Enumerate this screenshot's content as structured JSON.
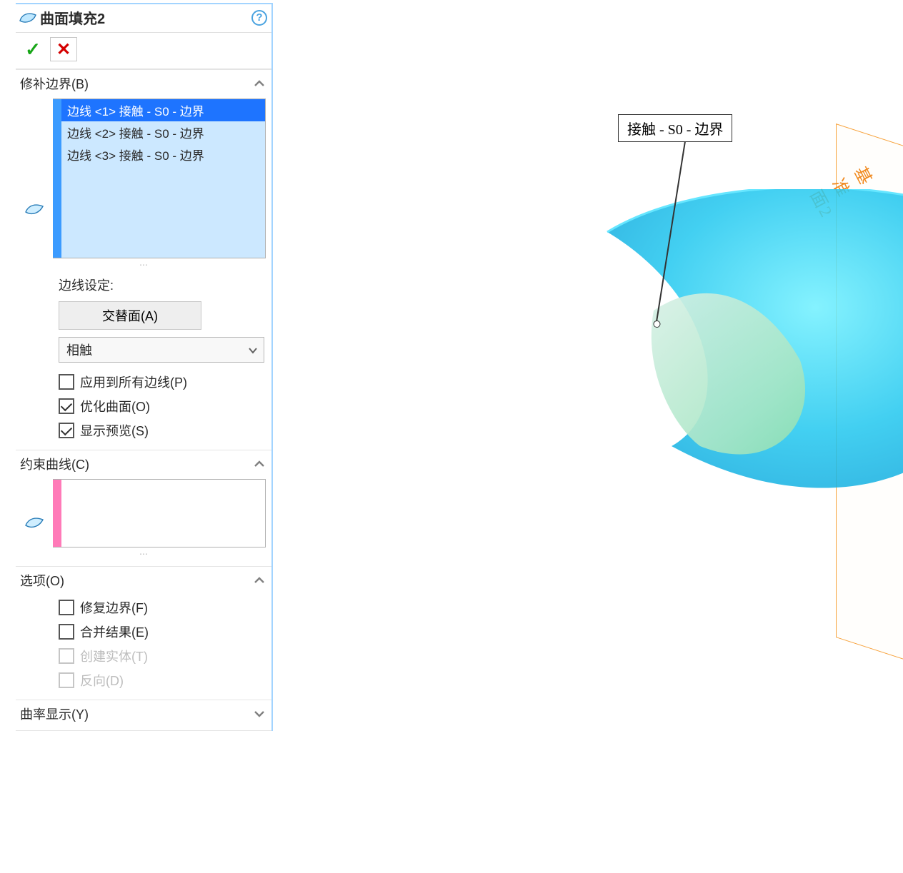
{
  "header": {
    "title": "曲面填充2"
  },
  "sections": {
    "patch_boundary": {
      "title": "修补边界(B)",
      "edges": [
        "边线 <1> 接触 - S0 - 边界",
        "边线 <2> 接触 - S0 - 边界",
        "边线 <3> 接触 - S0 - 边界"
      ],
      "selected_index": 0,
      "edge_settings_label": "边线设定:",
      "alternate_face_btn": "交替面(A)",
      "contact_combo": "相触",
      "apply_all_label": "应用到所有边线(P)",
      "apply_all_checked": false,
      "optimize_label": "优化曲面(O)",
      "optimize_checked": true,
      "preview_label": "显示预览(S)",
      "preview_checked": true
    },
    "constraint_curves": {
      "title": "约束曲线(C)"
    },
    "options": {
      "title": "选项(O)",
      "fix_boundary_label": "修复边界(F)",
      "fix_boundary_checked": false,
      "merge_result_label": "合并结果(E)",
      "merge_result_checked": false,
      "create_solid_label": "创建实体(T)",
      "create_solid_enabled": false,
      "reverse_label": "反向(D)",
      "reverse_enabled": false
    },
    "curvature_display": {
      "title": "曲率显示(Y)"
    }
  },
  "viewport": {
    "callout": "接触 - S0 - 边界",
    "datum_label": "基准面2"
  }
}
